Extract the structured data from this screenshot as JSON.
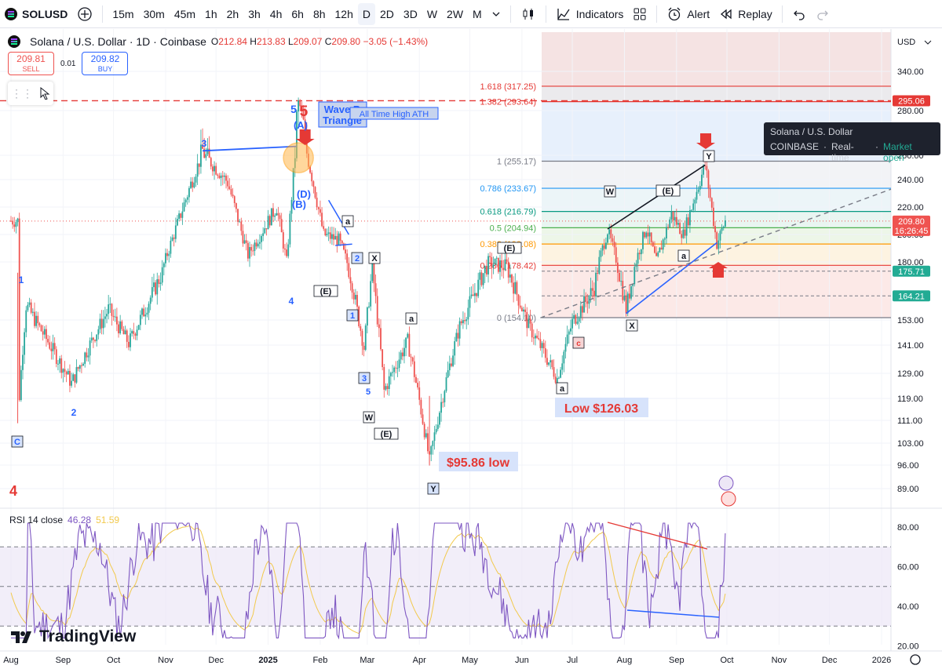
{
  "toolbar": {
    "symbol": "SOLUSD",
    "timeframes": [
      "15m",
      "30m",
      "45m",
      "1h",
      "2h",
      "3h",
      "4h",
      "6h",
      "8h",
      "12h",
      "D",
      "2D",
      "3D",
      "W",
      "2W",
      "M"
    ],
    "active_timeframe": "D",
    "indicators_label": "Indicators",
    "alert_label": "Alert",
    "replay_label": "Replay"
  },
  "legend": {
    "title": "Solana / U.S. Dollar · 1D · Coinbase",
    "open_label": "O",
    "open": "212.84",
    "high_label": "H",
    "high": "213.83",
    "low_label": "L",
    "low": "209.07",
    "close_label": "C",
    "close": "209.80",
    "change": "−3.05 (−1.43%)",
    "sell_price": "209.81",
    "sell_label": "SELL",
    "buy_price": "209.82",
    "buy_label": "BUY",
    "spread": "0.01"
  },
  "tooltip": {
    "title": "Solana / U.S. Dollar",
    "exchange": "COINBASE",
    "feed": "Real-time",
    "status": "Market open"
  },
  "rsi": {
    "label": "RSI 14 close",
    "value": "46.28",
    "ma_value": "51.59"
  },
  "branding": "TradingView",
  "colors": {
    "up": "#26a69a",
    "down": "#ef5350",
    "wave_blue": "#2962ff",
    "wave_red": "#e53935",
    "rsi": "#7e57c2",
    "rsi_ma": "#f2c94c"
  },
  "chart_data": {
    "type": "candlestick",
    "symbol": "SOLUSD",
    "interval": "1D",
    "currency": "USD",
    "x_ticks": [
      "Aug",
      "Sep",
      "Oct",
      "Nov",
      "Dec",
      "2025",
      "Feb",
      "Mar",
      "Apr",
      "May",
      "Jun",
      "Jul",
      "Aug",
      "Sep",
      "Oct",
      "Nov",
      "Dec",
      "2026"
    ],
    "y_ticks": [
      "340.00",
      "280.00",
      "260.00",
      "240.00",
      "220.00",
      "200.00",
      "180.00",
      "153.00",
      "141.00",
      "129.00",
      "119.00",
      "111.00",
      "103.00",
      "96.00",
      "89.00"
    ],
    "price_labels": [
      {
        "value": "295.06",
        "color": "#e53935"
      },
      {
        "value": "209.80",
        "sub": "16:26:45",
        "color": "#ef5350"
      },
      {
        "value": "175.71",
        "color": "#22ab94"
      },
      {
        "value": "164.21",
        "color": "#22ab94"
      }
    ],
    "fibonacci": [
      {
        "ratio": "1.618",
        "price": "317.25",
        "value": 317.25,
        "color": "#e53935"
      },
      {
        "ratio": "1.382",
        "price": "293.64",
        "value": 293.64,
        "color": "#e53935"
      },
      {
        "ratio": "1",
        "price": "255.17",
        "value": 255.17,
        "color": "#787b86"
      },
      {
        "ratio": "0.786",
        "price": "233.67",
        "value": 233.67,
        "color": "#2196f3"
      },
      {
        "ratio": "0.618",
        "price": "216.79",
        "value": 216.79,
        "color": "#089981"
      },
      {
        "ratio": "0.5",
        "price": "204.94",
        "value": 204.94,
        "color": "#4caf50"
      },
      {
        "ratio": "0.382",
        "price": "193.08",
        "value": 193.08,
        "color": "#ff9800"
      },
      {
        "ratio": "0.236",
        "price": "178.42",
        "value": 178.42,
        "color": "#e53935"
      },
      {
        "ratio": "0",
        "price": "154.10",
        "value": 154.1,
        "color": "#787b86"
      }
    ],
    "annotations": {
      "ath": "All Time High ATH",
      "wave_b": "Wave B",
      "triangle": "Triangle",
      "low_126": "Low $126.03",
      "low_95": "$95.86 low",
      "waves": [
        "1",
        "2",
        "3",
        "4",
        "5",
        "(A)",
        "(B)",
        "(C)",
        "(D)",
        "(E)",
        "a",
        "b",
        "c",
        "W",
        "X",
        "Y",
        "C",
        "4",
        "5",
        "3",
        "2",
        "1",
        "5"
      ]
    },
    "rsi_levels": [
      70,
      50,
      30
    ],
    "rsi_ticks": [
      "80.00",
      "60.00",
      "40.00",
      "20.00"
    ],
    "key_points": [
      {
        "date": "2024-08-05",
        "price": 110
      },
      {
        "date": "2024-11-23",
        "price": 264
      },
      {
        "date": "2025-01-19",
        "price": 295
      },
      {
        "date": "2025-04-07",
        "price": 95.86
      },
      {
        "date": "2025-06-22",
        "price": 126.03
      },
      {
        "date": "2025-09-18",
        "price": 253
      },
      {
        "date": "2025-09-30",
        "price": 209.8
      }
    ]
  }
}
